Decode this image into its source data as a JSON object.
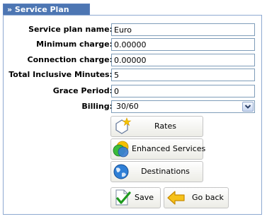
{
  "tab": {
    "title": "» Service Plan"
  },
  "form": {
    "fields": [
      {
        "label": "Service plan name:",
        "value": "Euro"
      },
      {
        "label": "Minimum charge:",
        "value": "0.00000"
      },
      {
        "label": "Connection charge:",
        "value": "0.00000"
      },
      {
        "label": "Total Inclusive Minutes:",
        "value": "5"
      },
      {
        "label": "Grace Period:",
        "value": "0"
      }
    ],
    "billing": {
      "label": "Billing:",
      "value": "30/60"
    }
  },
  "buttons": {
    "rates": "Rates",
    "enhanced_services": "Enhanced Services",
    "destinations": "Destinations",
    "save": "Save",
    "go_back": "Go back"
  },
  "colors": {
    "tab_bg": "#4d76b3",
    "panel_border": "#8ea9d1"
  }
}
